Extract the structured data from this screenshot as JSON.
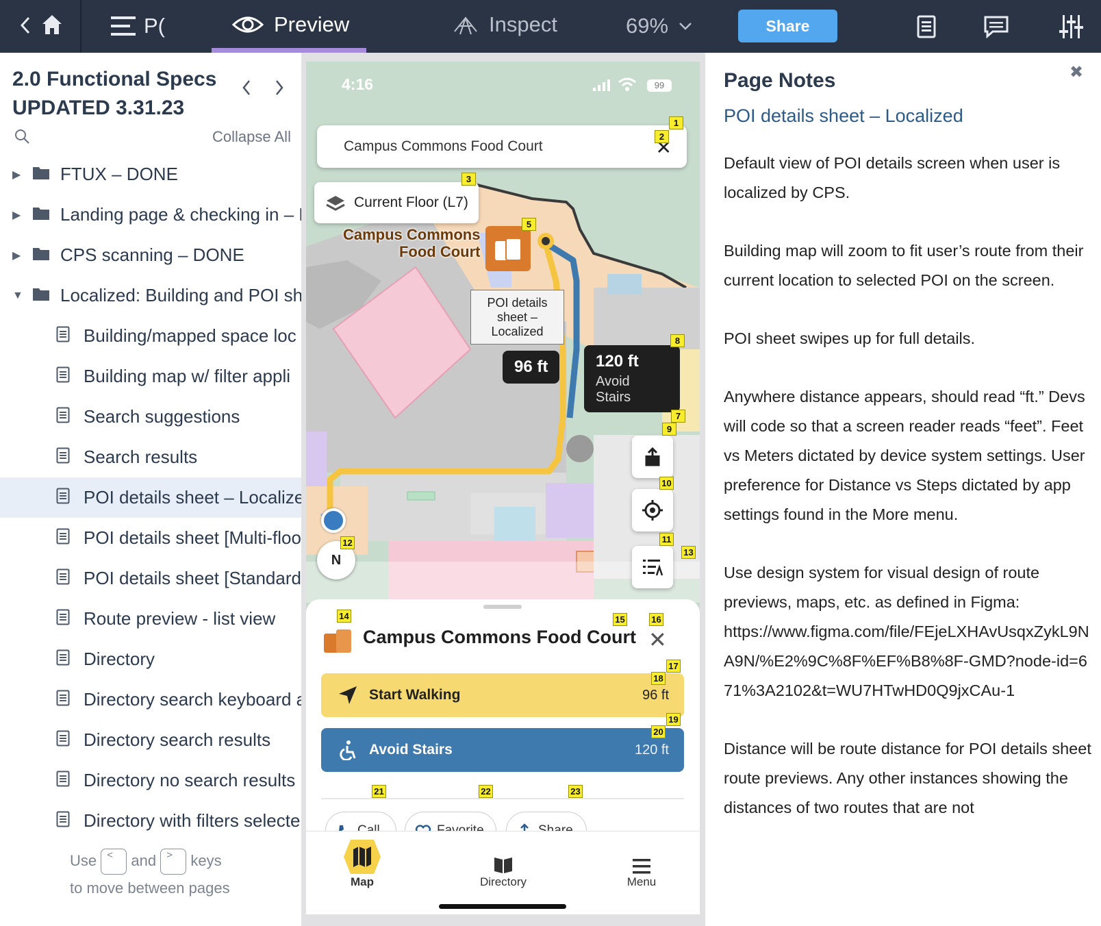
{
  "toolbar": {
    "back_icon": "chevron-left-icon",
    "home_icon": "home-icon",
    "menu_label": "P(",
    "preview_label": "Preview",
    "inspect_label": "Inspect",
    "zoom": "69%",
    "share_label": "Share",
    "accent": "#a78bdb",
    "share_color": "#53a7ee"
  },
  "sidebar": {
    "project_title": "2.0 Functional Specs UPDATED 3.31.23",
    "collapse_label": "Collapse All",
    "items": [
      {
        "type": "folder",
        "label": "FTUX – DONE",
        "expanded": false
      },
      {
        "type": "folder",
        "label": "Landing page & checking in – D",
        "expanded": false
      },
      {
        "type": "folder",
        "label": "CPS scanning – DONE",
        "expanded": false
      },
      {
        "type": "folder",
        "label": "Localized: Building and POI sh",
        "expanded": true
      },
      {
        "type": "page",
        "label": "Building/mapped space loc"
      },
      {
        "type": "page",
        "label": "Building map w/ filter appli"
      },
      {
        "type": "page",
        "label": "Search suggestions"
      },
      {
        "type": "page",
        "label": "Search results"
      },
      {
        "type": "page",
        "label": "POI details sheet – Localize",
        "selected": true
      },
      {
        "type": "page",
        "label": "POI details sheet [Multi-floo"
      },
      {
        "type": "page",
        "label": "POI details sheet [Standard"
      },
      {
        "type": "page",
        "label": "Route preview - list view"
      },
      {
        "type": "page",
        "label": "Directory"
      },
      {
        "type": "page",
        "label": "Directory search keyboard a"
      },
      {
        "type": "page",
        "label": "Directory search results"
      },
      {
        "type": "page",
        "label": "Directory no search results"
      },
      {
        "type": "page",
        "label": "Directory with filters selecte"
      }
    ],
    "hint_use": "Use",
    "hint_and": "and",
    "hint_keys": "keys",
    "hint_line2": "to move between pages",
    "key_prev": "<",
    "key_next": ">"
  },
  "phone": {
    "time": "4:16",
    "battery": "99",
    "search_value": "Campus Commons Food Court",
    "floor_label": "Current Floor (L7)",
    "poi_map_label_1": "Campus Commons",
    "poi_map_label_2": "Food Court",
    "tooltip_1": "POI details",
    "tooltip_2": "sheet –",
    "tooltip_3": "Localized",
    "badge_walk": "96 ft",
    "badge_stairs_dist": "120 ft",
    "badge_stairs_label": "Avoid Stairs",
    "compass": "N",
    "sheet_title": "Campus Commons Food Court",
    "start_walking": "Start Walking",
    "start_walking_dist": "96 ft",
    "avoid_stairs": "Avoid Stairs",
    "avoid_stairs_dist": "120 ft",
    "actions": [
      "Call",
      "Favorite",
      "Share"
    ],
    "tabs": [
      "Map",
      "Directory",
      "Menu"
    ],
    "route_yellow": "#f6d970",
    "route_blue": "#3f7aae"
  },
  "markers": [
    "1",
    "2",
    "3",
    "5",
    "7",
    "8",
    "9",
    "10",
    "11",
    "12",
    "13",
    "14",
    "15",
    "16",
    "17",
    "18",
    "19",
    "20",
    "21",
    "22",
    "23"
  ],
  "notes": {
    "title": "Page Notes",
    "subtitle": "POI details sheet – Localized",
    "paragraphs": [
      "Default view of POI details screen when user is localized by CPS.",
      "Building map will zoom to fit user’s route from their current location to selected POI on the screen.",
      "POI sheet swipes up for full details.",
      "Anywhere distance appears, should read “ft.” Devs will code so that a screen reader reads “feet”. Feet vs Meters dictated by device system settings. User preference for Distance vs Steps dictated by app settings found in the More menu.",
      "Use design system for visual design of route previews, maps, etc. as defined in Figma:",
      "Distance will be route distance for POI details sheet route previews. Any other instances showing the distances of two routes that are not"
    ],
    "figma_url": "https://www.figma.com/file/FEjeLXHAvUsqxZykL9NA9N/%E2%9C%8F%EF%B8%8F-GMD?node-id=671%3A2102&t=WU7HTwHD0Q9jxCAu-1"
  }
}
